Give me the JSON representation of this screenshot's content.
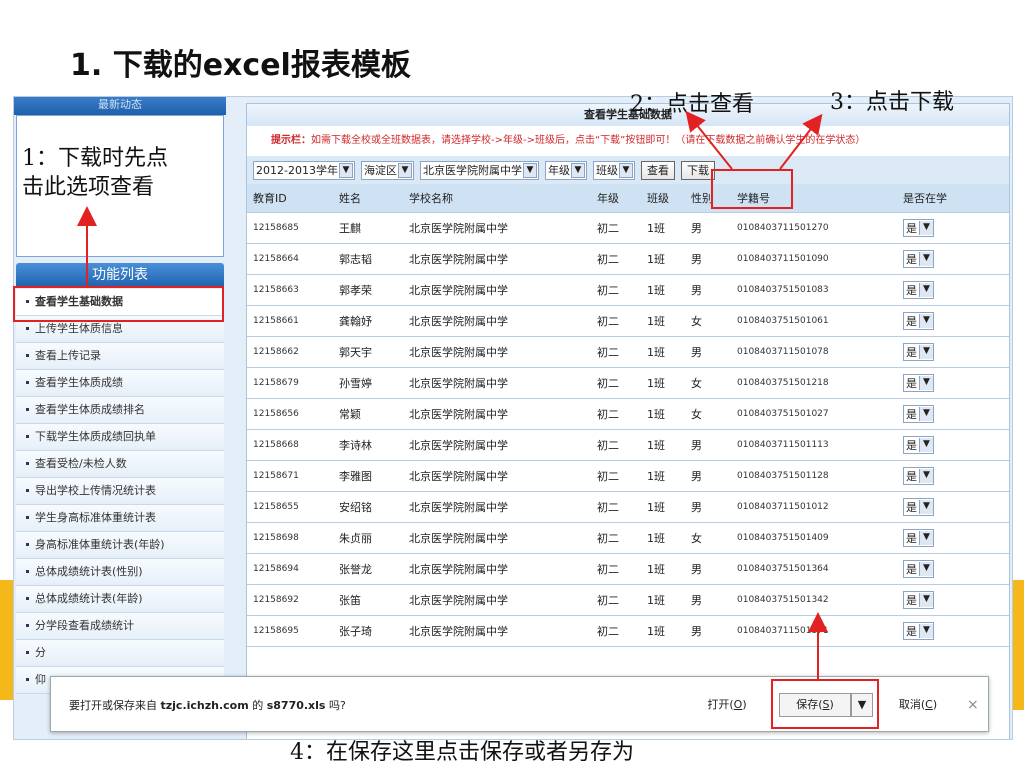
{
  "slide": {
    "title": "1. 下载的excel报表模板",
    "annotation_1": "1：下载时先点\n击此选项查看",
    "annotation_2": "2：点击查看",
    "annotation_3": "3：点击下载",
    "annotation_4": "4：在保存这里点击保存或者另存为",
    "arrow_color": "#e22222"
  },
  "sidebar": {
    "top_header": "最新动态",
    "func_header": "功能列表",
    "items": [
      "查看学生基础数据",
      "上传学生体质信息",
      "查看上传记录",
      "查看学生体质成绩",
      "查看学生体质成绩排名",
      "下载学生体质成绩回执单",
      "查看受检/未检人数",
      "导出学校上传情况统计表",
      "学生身高标准体重统计表",
      "身高标准体重统计表(年龄)",
      "总体成绩统计表(性别)",
      "总体成绩统计表(年龄)",
      "分学段查看成绩统计",
      "分",
      "仰"
    ],
    "active_index": 0
  },
  "main": {
    "title": "查看学生基础数据",
    "hint_label": "提示栏：",
    "hint_text": "如需下载全校或全班数据表，请选择学校->年级->班级后，点击“下载”按钮即可！（请在下载数据之前确认学生的在学状态）",
    "filters": {
      "year": "2012-2013学年",
      "district": "海淀区",
      "school": "北京医学院附属中学",
      "grade": "年级",
      "class": "班级"
    },
    "view_button": "查看",
    "download_button": "下载",
    "columns": [
      "教育ID",
      "姓名",
      "学校名称",
      "年级",
      "班级",
      "性别",
      "学籍号",
      "是否在学"
    ],
    "rows": [
      [
        "12158685",
        "王麒",
        "北京医学院附属中学",
        "初二",
        "1班",
        "男",
        "0108403711501270",
        "是"
      ],
      [
        "12158664",
        "郭志韬",
        "北京医学院附属中学",
        "初二",
        "1班",
        "男",
        "0108403711501090",
        "是"
      ],
      [
        "12158663",
        "郭孝荣",
        "北京医学院附属中学",
        "初二",
        "1班",
        "男",
        "0108403751501083",
        "是"
      ],
      [
        "12158661",
        "龚翰妤",
        "北京医学院附属中学",
        "初二",
        "1班",
        "女",
        "0108403751501061",
        "是"
      ],
      [
        "12158662",
        "郭天宇",
        "北京医学院附属中学",
        "初二",
        "1班",
        "男",
        "0108403711501078",
        "是"
      ],
      [
        "12158679",
        "孙雪婷",
        "北京医学院附属中学",
        "初二",
        "1班",
        "女",
        "0108403751501218",
        "是"
      ],
      [
        "12158656",
        "常颖",
        "北京医学院附属中学",
        "初二",
        "1班",
        "女",
        "0108403751501027",
        "是"
      ],
      [
        "12158668",
        "李诗林",
        "北京医学院附属中学",
        "初二",
        "1班",
        "男",
        "0108403711501113",
        "是"
      ],
      [
        "12158671",
        "李雅图",
        "北京医学院附属中学",
        "初二",
        "1班",
        "男",
        "0108403751501128",
        "是"
      ],
      [
        "12158655",
        "安绍铭",
        "北京医学院附属中学",
        "初二",
        "1班",
        "男",
        "0108403711501012",
        "是"
      ],
      [
        "12158698",
        "朱贞丽",
        "北京医学院附属中学",
        "初二",
        "1班",
        "女",
        "0108403751501409",
        "是"
      ],
      [
        "12158694",
        "张誉龙",
        "北京医学院附属中学",
        "初二",
        "1班",
        "男",
        "0108403751501364",
        "是"
      ],
      [
        "12158692",
        "张笛",
        "北京医学院附属中学",
        "初二",
        "1班",
        "男",
        "0108403751501342",
        "是"
      ],
      [
        "12158695",
        "张子琦",
        "北京医学院附属中学",
        "初二",
        "1班",
        "男",
        "0108403711501371",
        "是"
      ]
    ]
  },
  "download_bar": {
    "prefix": "要打开或保存来自 ",
    "host": "tzjc.ichzh.com",
    "middle": " 的 ",
    "filename": "s8770.xls",
    "suffix": " 吗?",
    "open_label": "打开(",
    "open_key": "O",
    "save_label": "保存(",
    "save_key": "S",
    "cancel_label": "取消(",
    "cancel_key": "C",
    "close_symbol": "×"
  }
}
